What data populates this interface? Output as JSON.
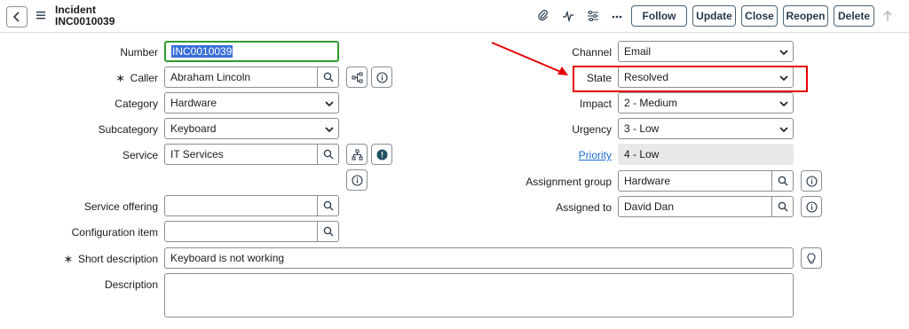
{
  "header": {
    "record_type": "Incident",
    "record_number": "INC0010039",
    "buttons": {
      "follow": "Follow",
      "update": "Update",
      "close": "Close",
      "reopen": "Reopen",
      "delete": "Delete"
    }
  },
  "left": {
    "number": {
      "label": "Number",
      "value": "INC0010039"
    },
    "caller": {
      "label": "Caller",
      "value": "Abraham Lincoln",
      "required_mark": "∗"
    },
    "category": {
      "label": "Category",
      "value": "Hardware"
    },
    "subcategory": {
      "label": "Subcategory",
      "value": "Keyboard"
    },
    "service": {
      "label": "Service",
      "value": "IT Services"
    },
    "service_offering": {
      "label": "Service offering",
      "value": ""
    },
    "configuration_item": {
      "label": "Configuration item",
      "value": ""
    }
  },
  "right": {
    "channel": {
      "label": "Channel",
      "value": "Email"
    },
    "state": {
      "label": "State",
      "value": "Resolved"
    },
    "impact": {
      "label": "Impact",
      "value": "2 - Medium"
    },
    "urgency": {
      "label": "Urgency",
      "value": "3 - Low"
    },
    "priority": {
      "label": "Priority",
      "value": "4 - Low"
    },
    "assignment_group": {
      "label": "Assignment group",
      "value": "Hardware"
    },
    "assigned_to": {
      "label": "Assigned to",
      "value": "David Dan"
    }
  },
  "short_description": {
    "label": "Short description",
    "value": "Keyboard is not working",
    "required_mark": "∗"
  },
  "description": {
    "label": "Description",
    "value": ""
  },
  "colors": {
    "highlight": "#e60000",
    "link": "#1f6fd1",
    "focus": "#2e9c2e"
  }
}
